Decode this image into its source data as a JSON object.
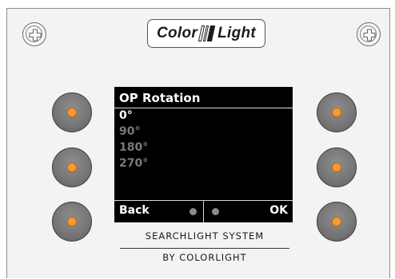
{
  "logo": {
    "word_left": "Color",
    "word_right": "Light"
  },
  "screen": {
    "title": "OP Rotation",
    "options": [
      {
        "label": "0°",
        "selected": true
      },
      {
        "label": "90°",
        "selected": false
      },
      {
        "label": "180°",
        "selected": false
      },
      {
        "label": "270°",
        "selected": false
      }
    ],
    "back_label": "Back",
    "ok_label": "OK"
  },
  "branding": {
    "line1": "SEARCHLIGHT SYSTEM",
    "line2": "BY COLORLIGHT"
  },
  "colors": {
    "led": "#f79a33",
    "button": "#777777",
    "screen_bg": "#000000",
    "selected_text": "#ffffff",
    "unselected_text": "#7a7a7a"
  }
}
